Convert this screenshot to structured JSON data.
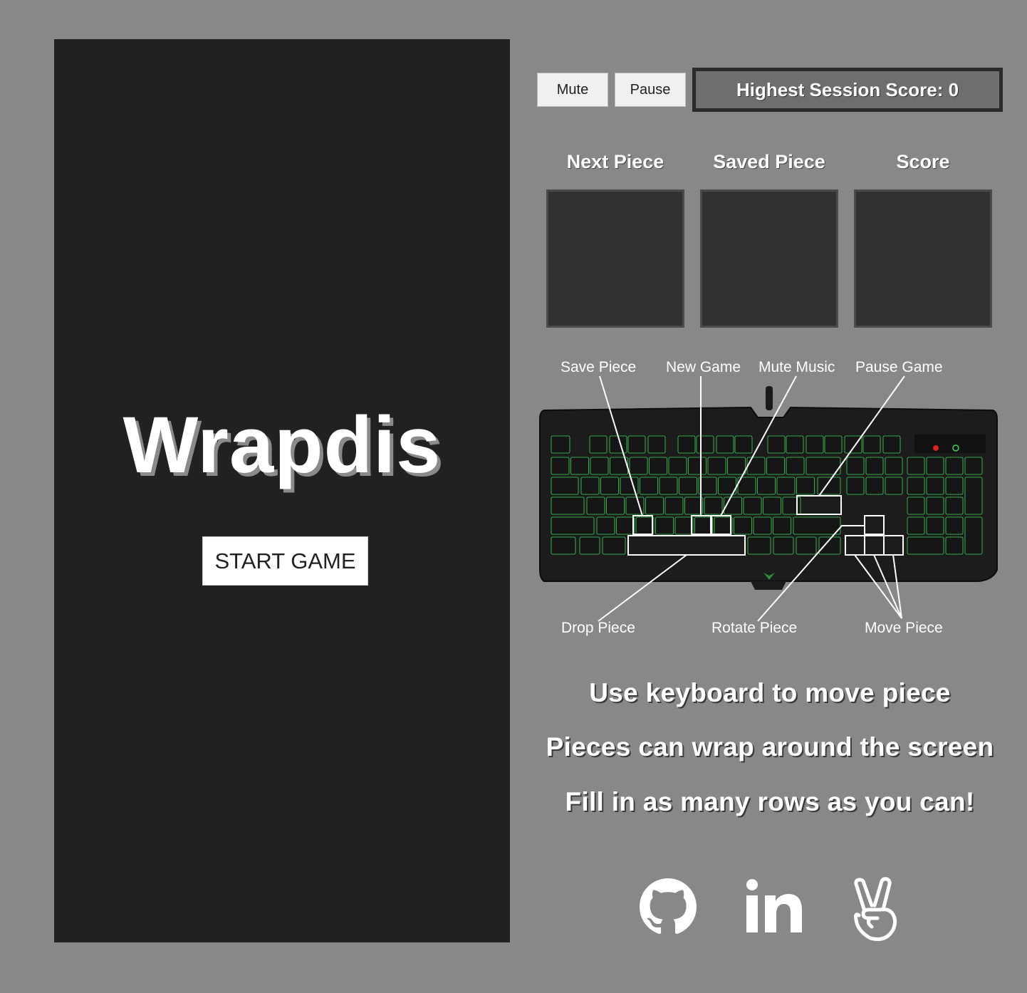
{
  "game": {
    "title": "Wrapdis",
    "start_label": "START GAME"
  },
  "controls": {
    "mute_label": "Mute",
    "pause_label": "Pause",
    "high_score_text": "Highest Session Score: 0"
  },
  "panels": [
    {
      "label": "Next Piece"
    },
    {
      "label": "Saved Piece"
    },
    {
      "label": "Score"
    }
  ],
  "keyboard": {
    "labels": {
      "save_piece": "Save Piece",
      "new_game": "New Game",
      "mute_music": "Mute Music",
      "pause_game": "Pause Game",
      "drop_piece": "Drop Piece",
      "rotate_piece": "Rotate Piece",
      "move_piece": "Move Piece"
    },
    "key_color": "#3dd65a"
  },
  "instructions": [
    "Use keyboard to move piece",
    "Pieces can wrap around the screen",
    "Fill in as many rows as you can!"
  ],
  "social": [
    "github-icon",
    "linkedin-icon",
    "peace-hand-icon"
  ]
}
